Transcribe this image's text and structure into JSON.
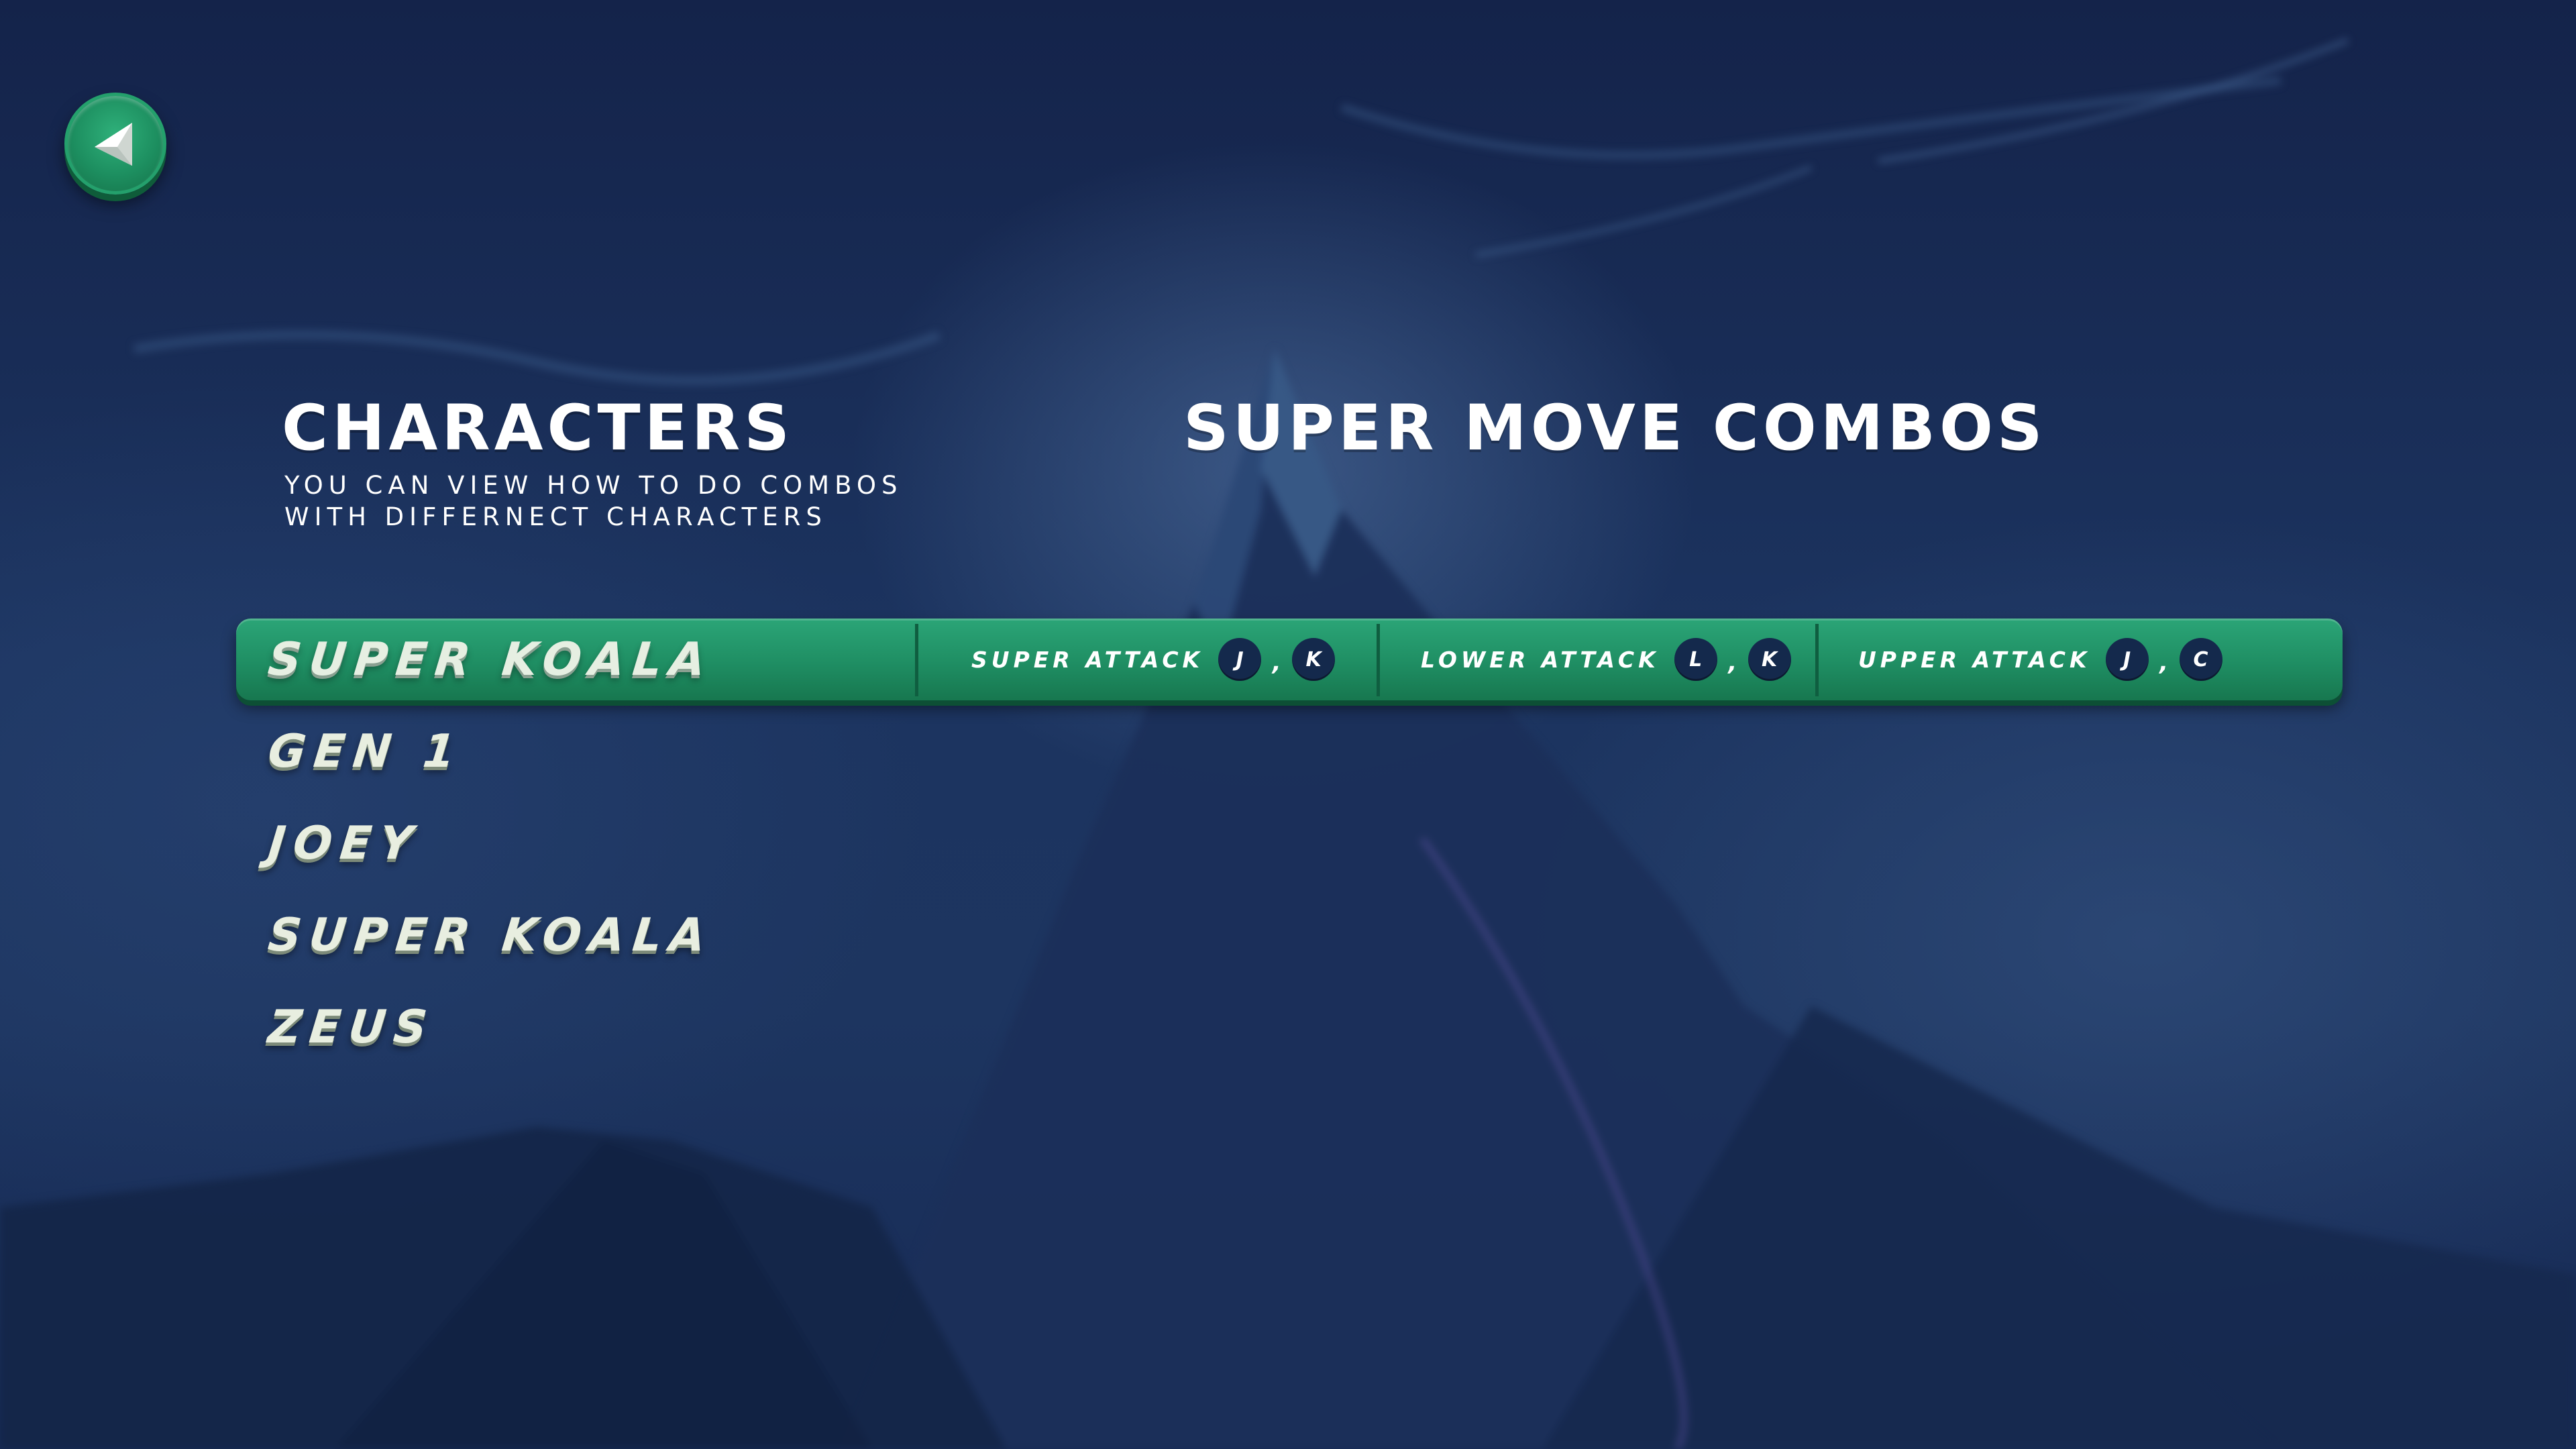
{
  "header": {
    "characters_title": "CHARACTERS",
    "subtitle_lines": [
      "YOU CAN VIEW HOW TO DO COMBOS",
      "WITH DIFFERNECT CHARACTERS"
    ],
    "combos_title": "SUPER MOVE COMBOS"
  },
  "back_button": {
    "icon": "back-arrow-icon"
  },
  "characters": [
    {
      "name": "SUPER KOALA",
      "selected": true
    },
    {
      "name": "GEN 1",
      "selected": false
    },
    {
      "name": "JOEY",
      "selected": false
    },
    {
      "name": "SUPER KOALA",
      "selected": false
    },
    {
      "name": "ZEUS",
      "selected": false
    }
  ],
  "combos": [
    {
      "label": "SUPER ATTACK",
      "keys": [
        "J",
        "K"
      ],
      "separator": ","
    },
    {
      "label": "LOWER ATTACK",
      "keys": [
        "L",
        "K"
      ],
      "separator": ","
    },
    {
      "label": "UPPER ATTACK",
      "keys": [
        "J",
        "C"
      ],
      "separator": ","
    }
  ],
  "colors": {
    "accent_green": "#1f8e63",
    "key_bubble": "#14294c",
    "background": "#1c3460"
  }
}
